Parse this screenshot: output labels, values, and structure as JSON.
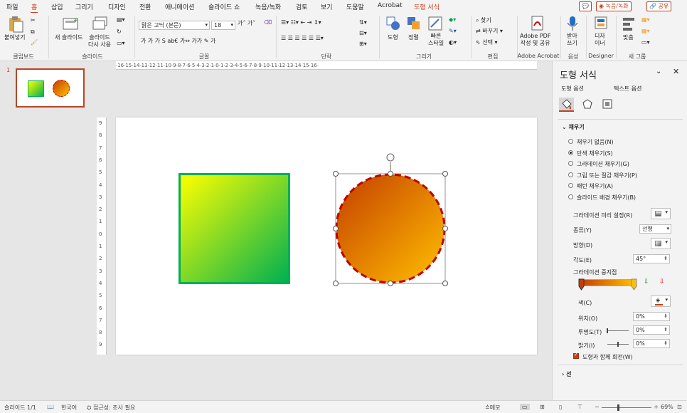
{
  "tabs": [
    "파일",
    "홈",
    "삽입",
    "그리기",
    "디자인",
    "전환",
    "애니메이션",
    "슬라이드 쇼",
    "녹음/녹화",
    "검토",
    "보기",
    "도움말",
    "Acrobat",
    "도형 서식"
  ],
  "active_tab": "홈",
  "title_buttons": {
    "comment": "💬",
    "record": "◉ 녹음/녹화",
    "share": "🔗 공유"
  },
  "ribbon": {
    "clipboard": {
      "paste": "붙여넣기",
      "label": "클립보드"
    },
    "slides": {
      "new_slide": "새 슬라이드",
      "reuse": "슬라이드\n다시 사용",
      "label": "슬라이드"
    },
    "font": {
      "name": "맑은 고딕 (본문)",
      "size": "18",
      "label": "글꼴",
      "row2": "가  가  가  S  ab€  가↔  가가  ✎  가"
    },
    "paragraph": {
      "label": "단락"
    },
    "drawing": {
      "shape": "도형",
      "arrange": "정렬",
      "quick_style": "빠른\n스타일",
      "label": "그리기"
    },
    "editing": {
      "find": "찾기",
      "replace": "바꾸기",
      "select": "선택",
      "label": "편집"
    },
    "acrobat": {
      "create": "Adobe PDF\n작성 및 공유",
      "label": "Adobe Acrobat"
    },
    "voice": {
      "dictate": "받아\n쓰기",
      "label": "음성"
    },
    "designer": {
      "designer": "디자\n이너",
      "label": "Designer"
    },
    "newgroup": {
      "fit": "맞춤",
      "label": "새 그룹"
    }
  },
  "thumbnail": {
    "number": "1"
  },
  "ruler_h": "·16·15·14·13·12·11·10·9·8·7·6·5·4·3·2·1·0·1·2·3·4·5·6·7·8·9·10·11·12·13·14·15·16·",
  "ruler_v": [
    "9",
    "8",
    "7",
    "6",
    "5",
    "4",
    "3",
    "2",
    "1",
    "0",
    "1",
    "2",
    "3",
    "4",
    "5",
    "6",
    "7",
    "8",
    "9"
  ],
  "pane": {
    "title": "도형 서식",
    "tab_shape": "도형 옵션",
    "tab_text": "텍스트 옵션",
    "fill_section": "채우기",
    "fill_options": [
      "채우기 없음(N)",
      "단색 채우기(S)",
      "그라데이션 채우기(G)",
      "그림 또는 질감 채우기(P)",
      "패턴 채우기(A)",
      "슬라이드 배경 채우기(B)"
    ],
    "selected_fill": 1,
    "preset_label": "그라데이션 미리 설정(R)",
    "type_label": "종류(Y)",
    "type_value": "선형",
    "direction_label": "방향(D)",
    "angle_label": "각도(E)",
    "angle_value": "45°",
    "stops_label": "그라데이션 중지점",
    "color_label": "색(C)",
    "position_label": "위치(O)",
    "position_value": "0%",
    "transparency_label": "투명도(T)",
    "transparency_value": "0%",
    "brightness_label": "밝기(I)",
    "brightness_value": "0%",
    "rotate_label": "도형과 함께 회전(W)",
    "line_section": "선"
  },
  "status": {
    "slide": "슬라이드 1/1",
    "language": "한국어",
    "accessibility": "접근성: 조사 필요",
    "notes": "메모",
    "zoom": "69%"
  },
  "colors": {
    "accent": "#c43e1c",
    "square_a": "#ffff00",
    "square_b": "#00b050",
    "circle_a": "#c43e00",
    "circle_b": "#ffc000",
    "circle_border": "#c00000"
  }
}
